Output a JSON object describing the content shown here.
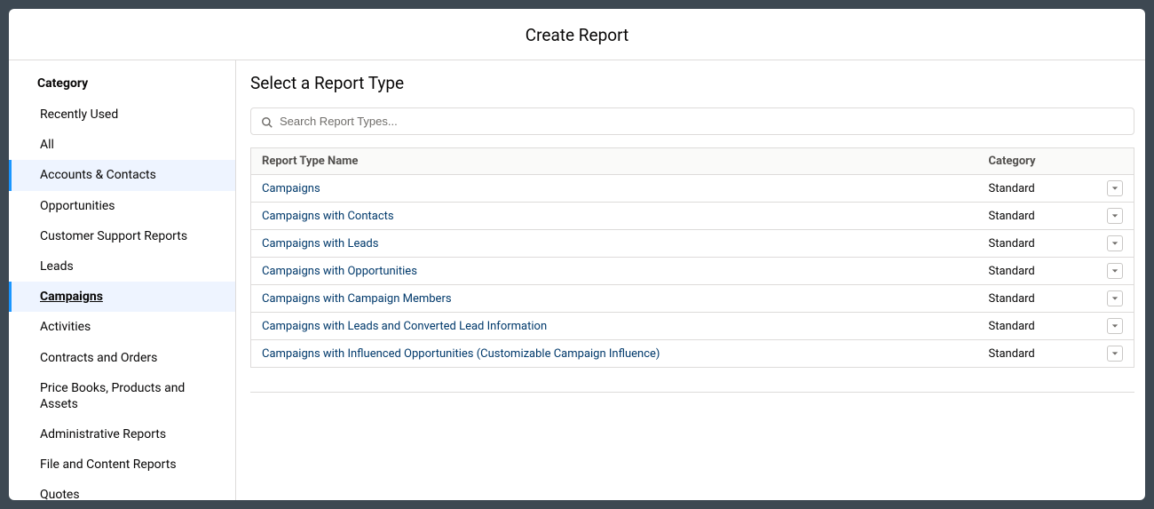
{
  "modal": {
    "title": "Create Report"
  },
  "sidebar": {
    "heading": "Category",
    "items": [
      {
        "label": "Recently Used",
        "state": ""
      },
      {
        "label": "All",
        "state": ""
      },
      {
        "label": "Accounts & Contacts",
        "state": "highlight"
      },
      {
        "label": "Opportunities",
        "state": ""
      },
      {
        "label": "Customer Support Reports",
        "state": ""
      },
      {
        "label": "Leads",
        "state": ""
      },
      {
        "label": "Campaigns",
        "state": "active"
      },
      {
        "label": "Activities",
        "state": ""
      },
      {
        "label": "Contracts and Orders",
        "state": ""
      },
      {
        "label": "Price Books, Products and Assets",
        "state": ""
      },
      {
        "label": "Administrative Reports",
        "state": ""
      },
      {
        "label": "File and Content Reports",
        "state": ""
      },
      {
        "label": "Quotes",
        "state": ""
      }
    ]
  },
  "main": {
    "title": "Select a Report Type",
    "search": {
      "placeholder": "Search Report Types..."
    },
    "columns": {
      "name": "Report Type Name",
      "category": "Category"
    },
    "rows": [
      {
        "name": "Campaigns",
        "category": "Standard"
      },
      {
        "name": "Campaigns with Contacts",
        "category": "Standard"
      },
      {
        "name": "Campaigns with Leads",
        "category": "Standard"
      },
      {
        "name": "Campaigns with Opportunities",
        "category": "Standard"
      },
      {
        "name": "Campaigns with Campaign Members",
        "category": "Standard"
      },
      {
        "name": "Campaigns with Leads and Converted Lead Information",
        "category": "Standard"
      },
      {
        "name": "Campaigns with Influenced Opportunities (Customizable Campaign Influence)",
        "category": "Standard"
      }
    ]
  }
}
